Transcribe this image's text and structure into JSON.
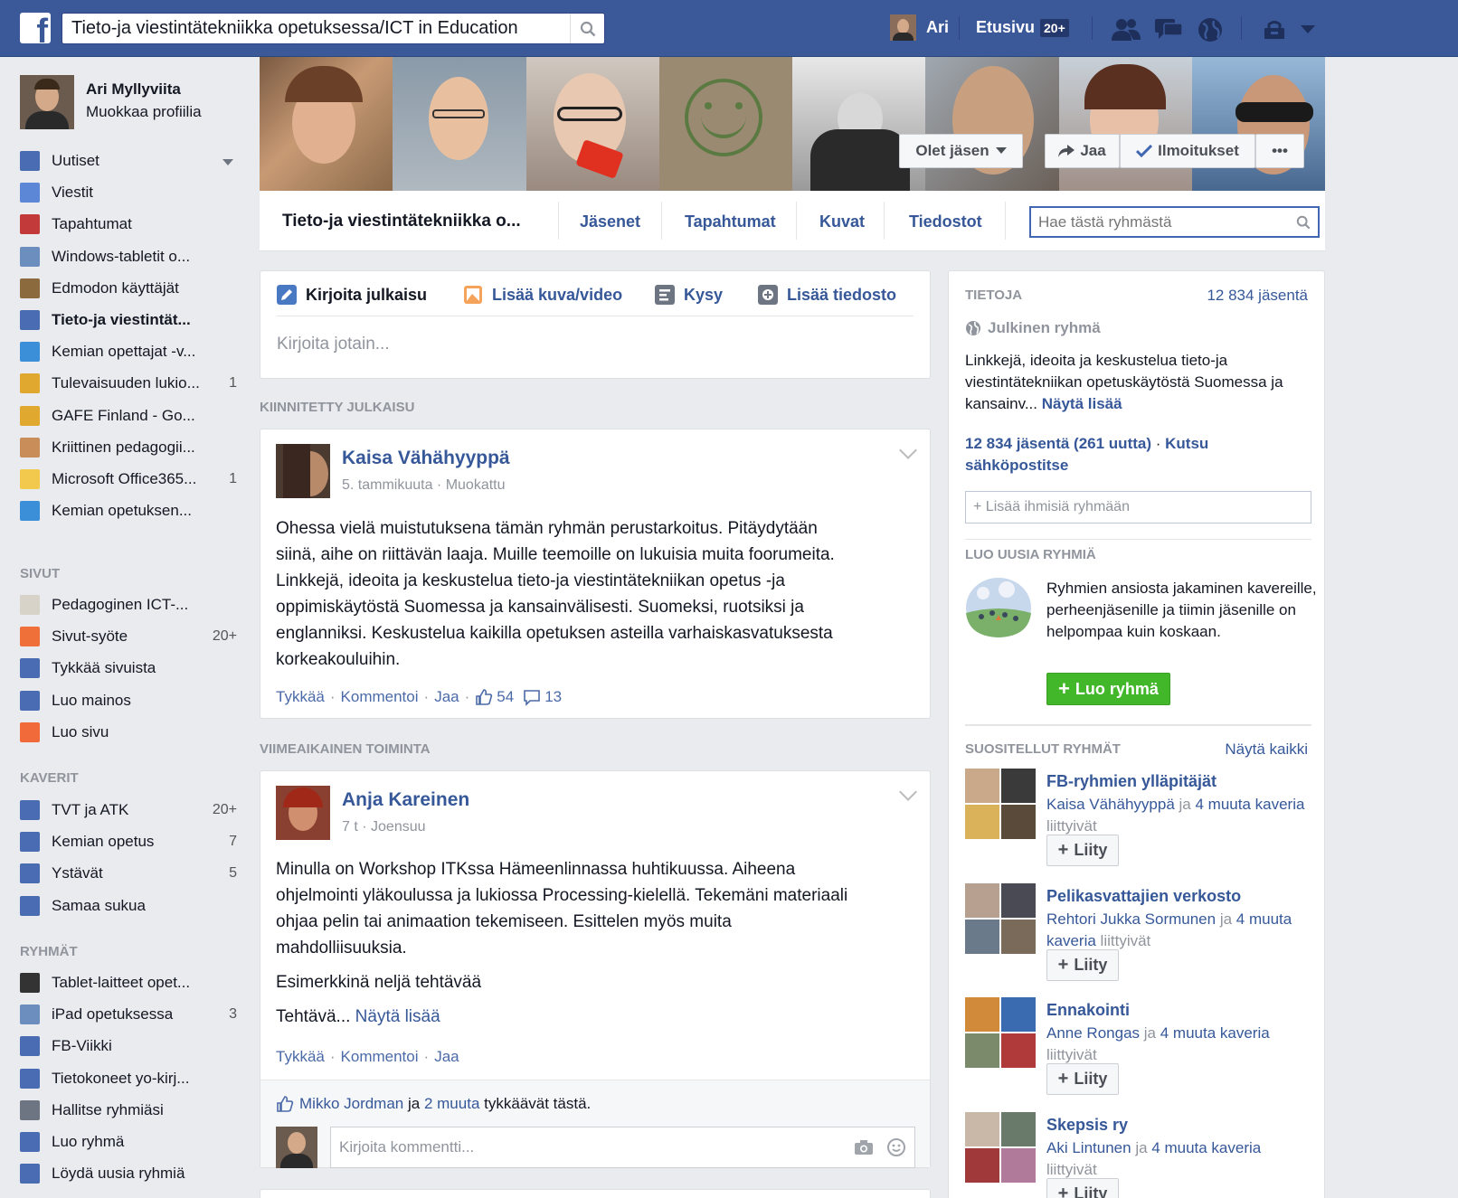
{
  "topbar": {
    "logo": "f",
    "search_value": "Tieto-ja viestintätekniikka opetuksessa/ICT in Education",
    "user_name": "Ari",
    "home_label": "Etusivu",
    "home_count": "20+"
  },
  "profile": {
    "name": "Ari Myllyviita",
    "edit_label": "Muokkaa profiilia"
  },
  "sidebar": {
    "main": [
      {
        "label": "Uutiset",
        "count": "",
        "icon": "newsfeed-icon",
        "color": "#4a6cb3"
      },
      {
        "label": "Viestit",
        "count": "",
        "icon": "messages-icon",
        "color": "#5b87d6"
      },
      {
        "label": "Tapahtumat",
        "count": "",
        "icon": "calendar-icon",
        "color": "#c23a3a"
      },
      {
        "label": "Windows-tabletit o...",
        "count": "",
        "icon": "globe-icon",
        "color": "#6c8ebf"
      },
      {
        "label": "Edmodon käyttäjät",
        "count": "",
        "icon": "book-icon",
        "color": "#8b6a3e"
      },
      {
        "label": "Tieto-ja viestintät...",
        "count": "",
        "icon": "group-icon",
        "color": "#4a6cb3",
        "active": true
      },
      {
        "label": "Kemian opettajat -v...",
        "count": "",
        "icon": "flask-icon",
        "color": "#3b8fd9"
      },
      {
        "label": "Tulevaisuuden lukio...",
        "count": "1",
        "icon": "school-icon",
        "color": "#e0a82e"
      },
      {
        "label": "GAFE Finland - Go...",
        "count": "",
        "icon": "school-icon",
        "color": "#e0a82e"
      },
      {
        "label": "Kriittinen pedagogii...",
        "count": "",
        "icon": "head-icon",
        "color": "#c98d5a"
      },
      {
        "label": "Microsoft Office365...",
        "count": "1",
        "icon": "bulb-icon",
        "color": "#f2c94c"
      },
      {
        "label": "Kemian opetuksen...",
        "count": "",
        "icon": "flask-icon",
        "color": "#3b8fd9"
      }
    ],
    "pages_header": "SIVUT",
    "pages": [
      {
        "label": "Pedagoginen ICT-...",
        "count": "",
        "icon": "page-thumb-icon",
        "color": "#d8d3c8"
      },
      {
        "label": "Sivut-syöte",
        "count": "20+",
        "icon": "flag-icon",
        "color": "#f0703a"
      },
      {
        "label": "Tykkää sivuista",
        "count": "",
        "icon": "like-icon",
        "color": "#4a6cb3"
      },
      {
        "label": "Luo mainos",
        "count": "",
        "icon": "chart-icon",
        "color": "#4a6cb3"
      },
      {
        "label": "Luo sivu",
        "count": "",
        "icon": "plus-page-icon",
        "color": "#f06a3a"
      }
    ],
    "friends_header": "KAVERIT",
    "friends": [
      {
        "label": "TVT ja ATK",
        "count": "20+",
        "icon": "friends-list-icon",
        "color": "#4a6cb3"
      },
      {
        "label": "Kemian opetus",
        "count": "7",
        "icon": "friends-list-icon",
        "color": "#4a6cb3"
      },
      {
        "label": "Ystävät",
        "count": "5",
        "icon": "friends-list-icon",
        "color": "#4a6cb3"
      },
      {
        "label": "Samaa sukua",
        "count": "",
        "icon": "friends-list-icon",
        "color": "#4a6cb3"
      }
    ],
    "groups_header": "RYHMÄT",
    "groups": [
      {
        "label": "Tablet-laitteet opet...",
        "count": "",
        "icon": "graduation-cap-icon",
        "color": "#333333"
      },
      {
        "label": "iPad opetuksessa",
        "count": "3",
        "icon": "globe-icon",
        "color": "#6c8ebf"
      },
      {
        "label": "FB-Viikki",
        "count": "",
        "icon": "group-icon",
        "color": "#4a6cb3"
      },
      {
        "label": "Tietokoneet yo-kirj...",
        "count": "",
        "icon": "group-icon",
        "color": "#4a6cb3"
      },
      {
        "label": "Hallitse ryhmiäsi",
        "count": "",
        "icon": "manage-groups-icon",
        "color": "#6d7582"
      },
      {
        "label": "Luo ryhmä",
        "count": "",
        "icon": "plus-icon",
        "color": "#4a6cb3"
      },
      {
        "label": "Löydä uusia ryhmiä",
        "count": "",
        "icon": "compass-icon",
        "color": "#4a6cb3"
      }
    ]
  },
  "cover": {
    "member_button": "Olet jäsen",
    "share_button": "Jaa",
    "notify_button": "Ilmoitukset",
    "more_button": "•••"
  },
  "group_nav": {
    "name": "Tieto-ja viestintätekniikka o...",
    "tabs": [
      "Jäsenet",
      "Tapahtumat",
      "Kuvat",
      "Tiedostot"
    ],
    "search_placeholder": "Hae tästä ryhmästä"
  },
  "composer": {
    "tabs": [
      "Kirjoita julkaisu",
      "Lisää kuva/video",
      "Kysy",
      "Lisää tiedosto"
    ],
    "placeholder": "Kirjoita jotain..."
  },
  "pinned_header": "KIINNITETTY JULKAISU",
  "pinned_post": {
    "author": "Kaisa Vähähyyppä",
    "date": "5. tammikuuta",
    "edited": "Muokattu",
    "lines": [
      "Ohessa vielä muistutuksena tämän ryhmän perustarkoitus. Pitäydytään",
      "siinä, aihe on riittävän laaja. Muille teemoille on lukuisia muita foorumeita.",
      "Linkkejä, ideoita ja keskustelua tieto-ja viestintätekniikan opetus -ja",
      "oppimiskäytöstä Suomessa ja kansainvälisesti. Suomeksi, ruotsiksi ja",
      "englanniksi. Keskustelua kaikilla opetuksen asteilla varhaiskasvatuksesta",
      "korkeakouluihin."
    ],
    "like": "Tykkää",
    "comment": "Kommentoi",
    "share": "Jaa",
    "likes": "54",
    "comments": "13"
  },
  "recent_header": "VIIMEAIKAINEN TOIMINTA",
  "recent_post": {
    "author": "Anja Kareinen",
    "time": "7 t",
    "place": "Joensuu",
    "lines": [
      "Minulla on Workshop ITKssa Hämeenlinnassa huhtikuussa. Aiheena",
      "ohjelmointi yläkoulussa ja lukiossa Processing-kielellä. Tekemäni materiaali",
      "ohjaa pelin tai animaation tekemiseen. Esittelen myös muita",
      "mahdolliisuuksia."
    ],
    "line2": "Esimerkkinä neljä tehtävää",
    "line3": "Tehtävä...",
    "see_more": "Näytä lisää",
    "like": "Tykkää",
    "comment": "Kommentoi",
    "share": "Jaa",
    "likers_name": "Mikko Jordman",
    "likers_and": "ja",
    "likers_more": "2 muuta",
    "likers_suffix": "tykkäävät tästä.",
    "comment_placeholder": "Kirjoita kommentti..."
  },
  "about": {
    "header": "TIETOJA",
    "members": "12 834 jäsentä",
    "type": "Julkinen ryhmä",
    "desc": "Linkkejä, ideoita ja keskustelua tieto-ja viestintätekniikan opetuskäytöstä Suomessa ja kansainv...",
    "see_more": "Näytä lisää",
    "members_count": "12 834 jäsentä",
    "new_count": "(261 uutta)",
    "invite": "Kutsu sähköpostitse",
    "add_placeholder": "+ Lisää ihmisiä ryhmään"
  },
  "create": {
    "header": "LUO UUSIA RYHMIÄ",
    "text": "Ryhmien ansiosta jakaminen kavereille, perheenjäsenille ja tiimin jäsenille on helpompaa kuin koskaan.",
    "button": "Luo ryhmä"
  },
  "suggested": {
    "header": "SUOSITELLUT RYHMÄT",
    "see_all": "Näytä kaikki",
    "join_label": "Liity",
    "groups": [
      {
        "name": "FB-ryhmien ylläpitäjät",
        "friend": "Kaisa Vähähyyppä",
        "and": "ja",
        "others": "4 muuta kaveria",
        "suffix": "liittyivät",
        "colors": [
          "#c9a98a",
          "#3a3a3a",
          "#d9b25a",
          "#5a4a3a"
        ]
      },
      {
        "name": "Pelikasvattajien verkosto",
        "friend": "Rehtori Jukka Sormunen",
        "and": "ja",
        "others": "4 muuta kaveria",
        "suffix": "liittyivät",
        "colors": [
          "#b8a090",
          "#4a4a55",
          "#6a7a8a",
          "#7a6a5a"
        ]
      },
      {
        "name": "Ennakointi",
        "friend": "Anne Rongas",
        "and": "ja",
        "others": "4 muuta kaveria",
        "suffix": "liittyivät",
        "colors": [
          "#d08a3a",
          "#3a6ab0",
          "#7a8a6a",
          "#b03a3a"
        ]
      },
      {
        "name": "Skepsis ry",
        "friend": "Aki Lintunen",
        "and": "ja",
        "others": "4 muuta kaveria",
        "suffix": "liittyivät",
        "colors": [
          "#c9b8a8",
          "#6a7a6a",
          "#a03a3a",
          "#b07a9a"
        ]
      }
    ]
  }
}
